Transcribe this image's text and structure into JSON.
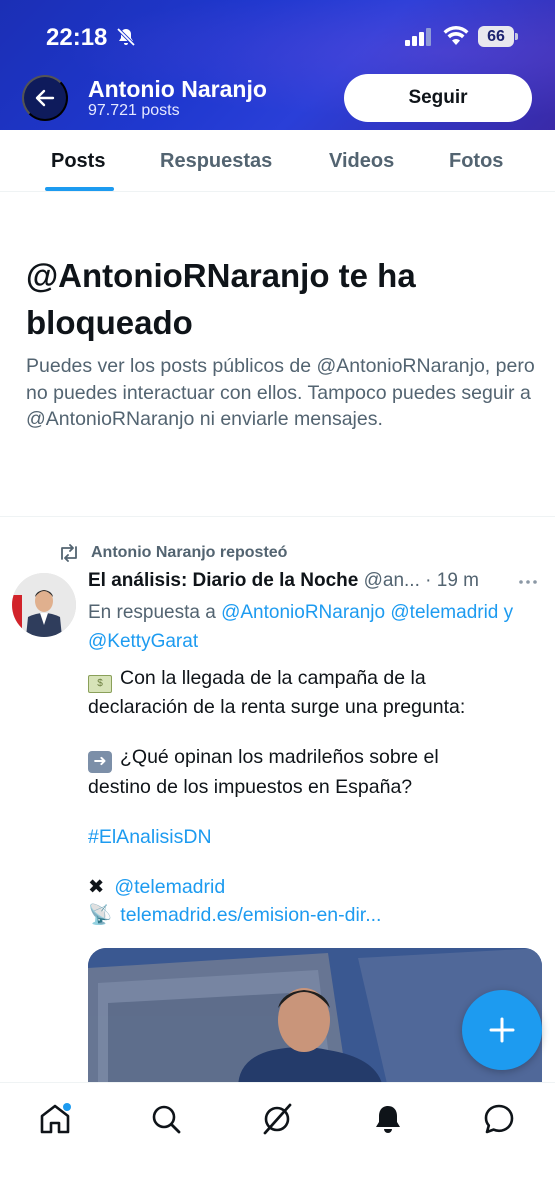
{
  "status_bar": {
    "time": "22:18",
    "battery": "66"
  },
  "header": {
    "name": "Antonio Naranjo",
    "posts_count": "97.721 posts",
    "follow_label": "Seguir"
  },
  "tabs": [
    {
      "label": "Posts"
    },
    {
      "label": "Respuestas"
    },
    {
      "label": "Videos"
    },
    {
      "label": "Fotos"
    }
  ],
  "blocked": {
    "title": "@AntonioRNaranjo te ha bloqueado",
    "text": "Puedes ver los posts públicos de @AntonioRNaranjo, pero no puedes interactuar con ellos. Tampoco puedes seguir a @AntonioRNaranjo ni enviarle mensajes."
  },
  "post": {
    "repost_label": "Antonio Naranjo reposteó",
    "author_name": "El análisis: Diario de la Noche",
    "author_handle": "@an...",
    "time": "· 19 m",
    "reply_prefix": "En respuesta a",
    "reply_mention_1": "@AntonioRNaranjo",
    "reply_mention_2": "@telemadrid",
    "reply_and": "y",
    "reply_mention_3": "@KettyGarat",
    "line1": "Con la llegada de la campaña de la",
    "line2": "declaración de la renta surge una pregunta:",
    "line3": "¿Qué opinan los madrileños sobre el",
    "line4": "destino de los impuestos en España?",
    "hashtag": "#ElAnalisisDN",
    "x_mention": "@telemadrid",
    "link": "telemadrid.es/emision-en-dir..."
  },
  "bottom_nav": [
    "home-icon",
    "search-icon",
    "grok-icon",
    "notifications-icon",
    "messages-icon"
  ],
  "colors": {
    "accent": "#1d9bf0",
    "header": "#1f38cf",
    "text": "#0f1419",
    "muted": "#536471"
  }
}
